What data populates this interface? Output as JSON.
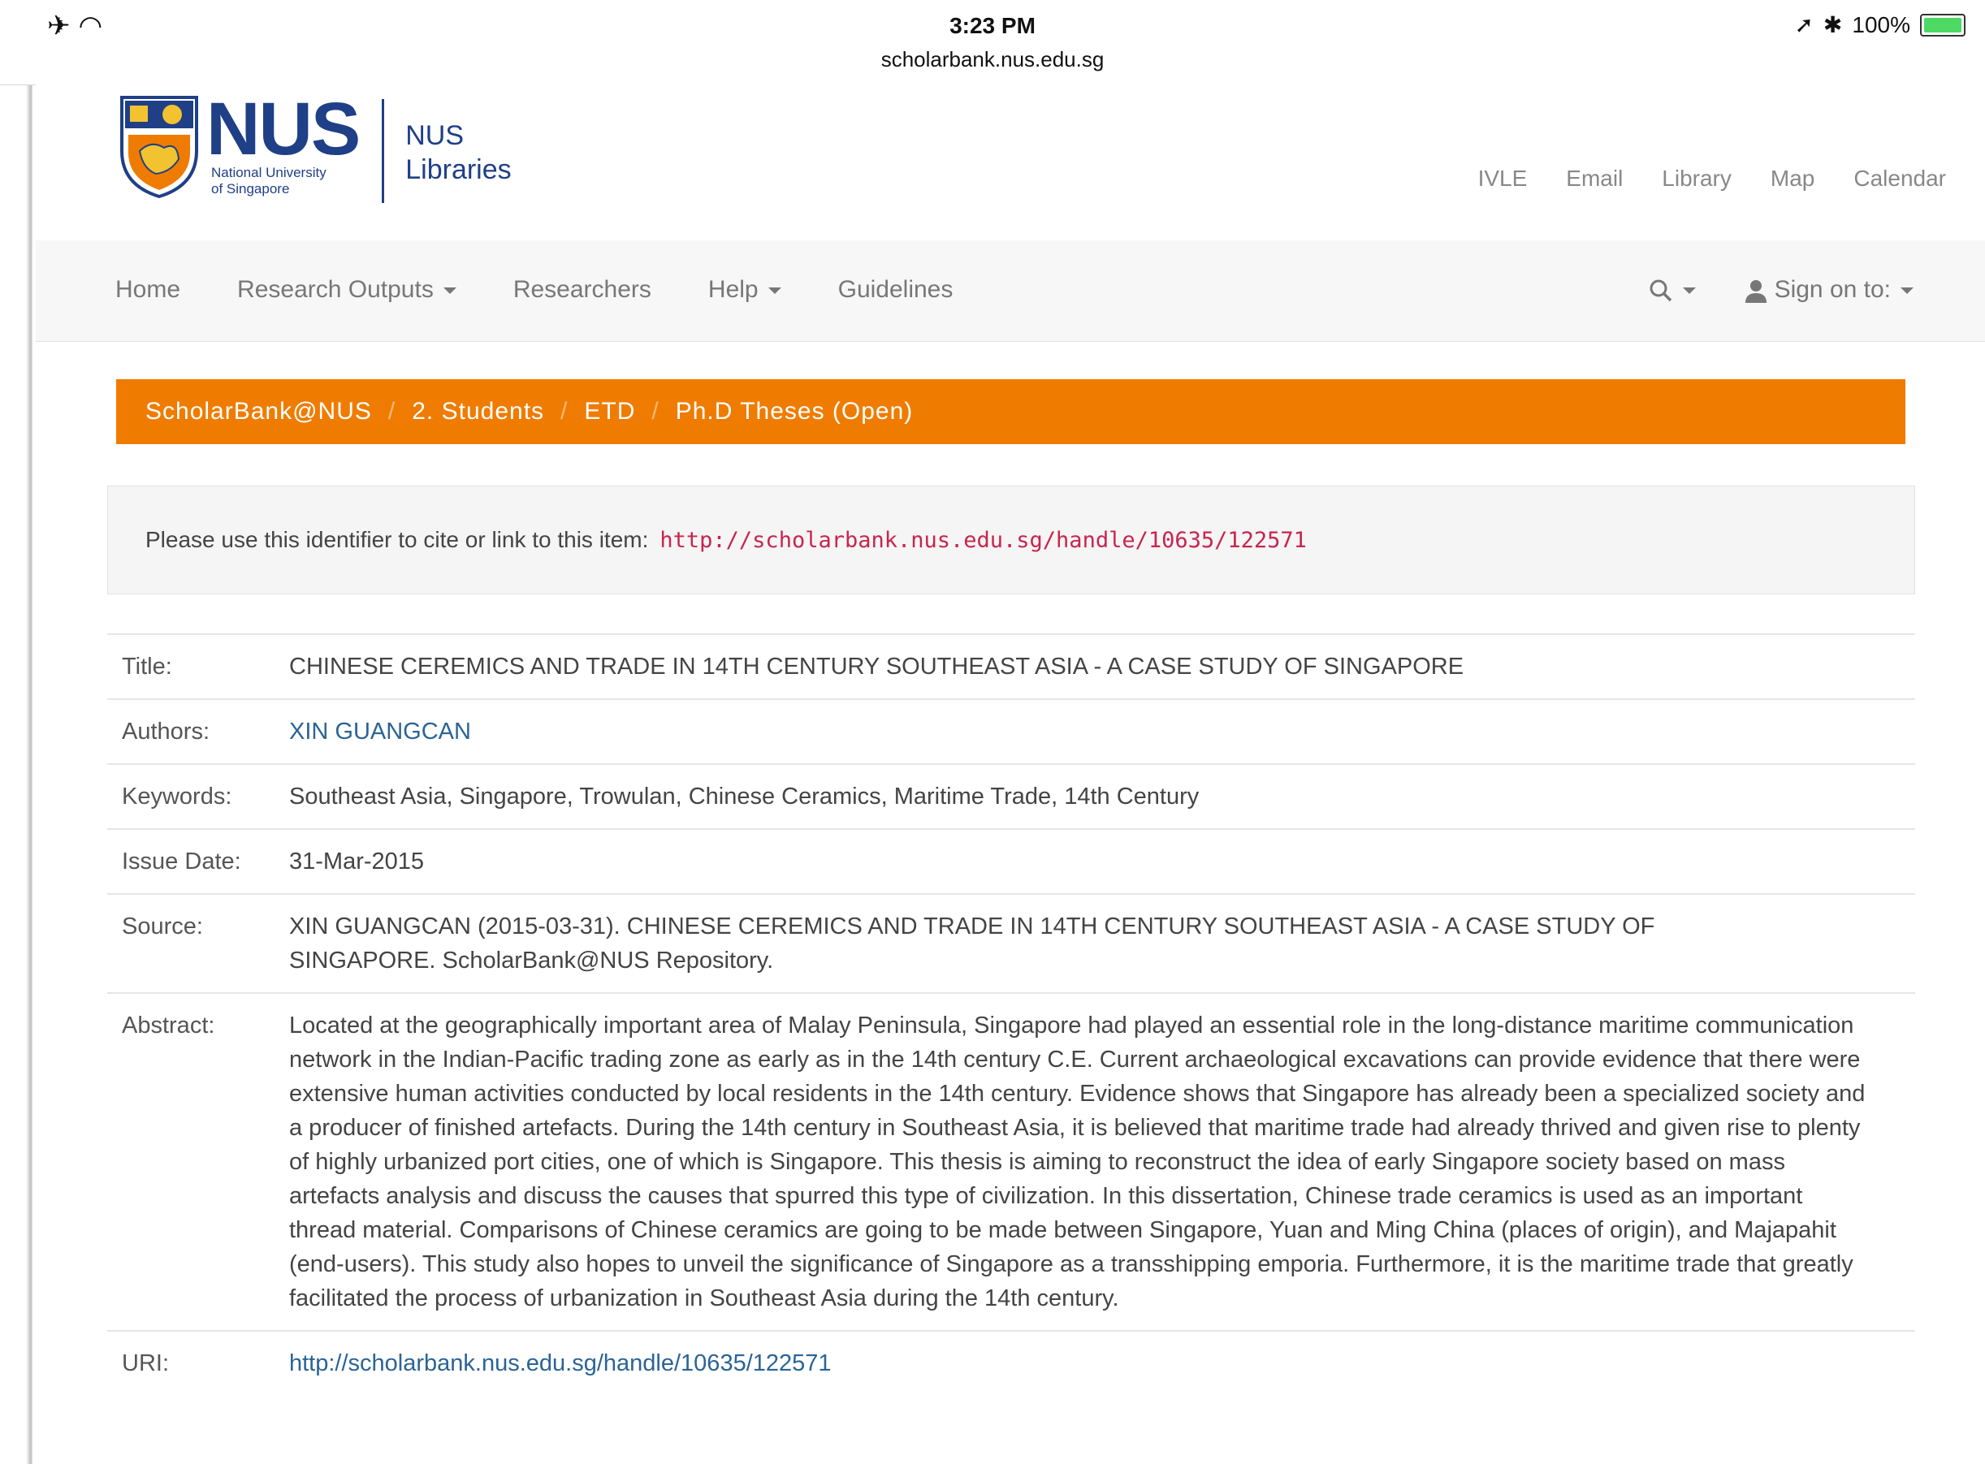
{
  "status": {
    "time": "3:23 PM",
    "url": "scholarbank.nus.edu.sg",
    "battery": "100%"
  },
  "header": {
    "logo_main": "NUS",
    "logo_sub_1": "National University",
    "logo_sub_2": "of Singapore",
    "lib_1": "NUS",
    "lib_2": "Libraries",
    "links": [
      "IVLE",
      "Email",
      "Library",
      "Map",
      "Calendar"
    ]
  },
  "nav": {
    "home": "Home",
    "research_outputs": "Research Outputs",
    "researchers": "Researchers",
    "help": "Help",
    "guidelines": "Guidelines",
    "sign_on": "Sign on to:"
  },
  "breadcrumb": [
    "ScholarBank@NUS",
    "2. Students",
    "ETD",
    "Ph.D Theses (Open)"
  ],
  "identifier": {
    "text": "Please use this identifier to cite or link to this item:",
    "link": "http://scholarbank.nus.edu.sg/handle/10635/122571"
  },
  "metadata": {
    "title_label": "Title:",
    "title": "CHINESE CEREMICS AND TRADE IN 14TH CENTURY SOUTHEAST ASIA - A CASE STUDY OF SINGAPORE",
    "authors_label": "Authors:",
    "authors": "XIN GUANGCAN",
    "keywords_label": "Keywords:",
    "keywords": "Southeast Asia, Singapore, Trowulan, Chinese Ceramics, Maritime Trade, 14th Century",
    "issue_label": "Issue Date:",
    "issue": "31-Mar-2015",
    "source_label": "Source:",
    "source": "XIN GUANGCAN (2015-03-31). CHINESE CEREMICS AND TRADE IN 14TH CENTURY SOUTHEAST ASIA - A CASE STUDY OF SINGAPORE. ScholarBank@NUS Repository.",
    "abstract_label": "Abstract:",
    "abstract": "Located at the geographically important area of Malay Peninsula, Singapore had played an essential role in the long-distance maritime communication network in the Indian-Pacific trading zone as early as in the 14th century C.E. Current archaeological excavations can provide evidence that there were extensive human activities conducted by local residents in the 14th century. Evidence shows that Singapore has already been a specialized society and a producer of finished artefacts.  During the 14th century in Southeast Asia, it is believed that maritime trade had already thrived and given rise to plenty of highly urbanized port cities, one of which is Singapore. This thesis is aiming to reconstruct the idea of early Singapore society based on mass artefacts analysis and discuss the causes that spurred this type of civilization.  In this dissertation, Chinese trade ceramics is used as an important thread material. Comparisons of Chinese ceramics are going to be made between Singapore, Yuan and Ming China (places of origin), and Majapahit (end-users). This study also hopes to unveil the significance of Singapore as a transshipping emporia. Furthermore, it is the maritime trade that greatly facilitated the process of urbanization in Southeast Asia during the 14th century.",
    "uri_label": "URI:",
    "uri": "http://scholarbank.nus.edu.sg/handle/10635/122571"
  },
  "colors": {
    "breadcrumb_bg": "#ef7c00",
    "brand_blue": "#1f3f87",
    "link": "#2a6496",
    "code_link": "#c7254e"
  }
}
